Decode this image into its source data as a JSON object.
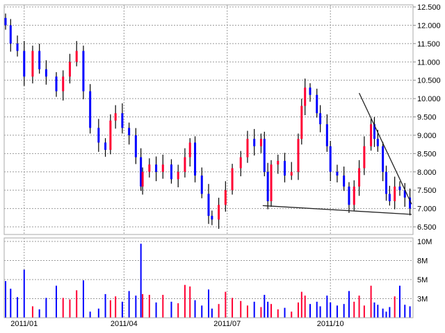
{
  "chart_data": {
    "type": "candlestick",
    "title": "",
    "price_axis": {
      "ticks": [
        "12.500",
        "12.000",
        "11.500",
        "11.000",
        "10.500",
        "10.000",
        "9.500",
        "9.000",
        "8.500",
        "8.000",
        "7.500",
        "7.000",
        "6.500"
      ],
      "ylim": [
        6.5,
        12.5
      ]
    },
    "volume_axis": {
      "ticks": [
        "10M",
        "8M",
        "5M",
        "3M"
      ]
    },
    "x_ticks": [
      {
        "label": "2011/01",
        "t": 11
      },
      {
        "label": "2011/04",
        "t": 70
      },
      {
        "label": "2011/07",
        "t": 131
      },
      {
        "label": "2011/10",
        "t": 192
      }
    ],
    "t_range": [
      0,
      240
    ],
    "points": [
      [
        0,
        12.0,
        4.8
      ],
      [
        3,
        11.5,
        3.8
      ],
      [
        7,
        11.3,
        2.7
      ],
      [
        11,
        10.6,
        6.3
      ],
      [
        16,
        11.3,
        1.5
      ],
      [
        20,
        10.8,
        1.1
      ],
      [
        24,
        10.6,
        2.6
      ],
      [
        30,
        10.2,
        4.2
      ],
      [
        34,
        10.6,
        2.6
      ],
      [
        38,
        11.0,
        2.4
      ],
      [
        42,
        11.3,
        3.6
      ],
      [
        46,
        10.2,
        4.9
      ],
      [
        50,
        9.2,
        0.8
      ],
      [
        55,
        8.8,
        1.2
      ],
      [
        59,
        8.6,
        3.1
      ],
      [
        62,
        9.4,
        2.3
      ],
      [
        65,
        9.6,
        2.8
      ],
      [
        69,
        9.2,
        2.1
      ],
      [
        73,
        9.0,
        3.5
      ],
      [
        77,
        8.4,
        2.9
      ],
      [
        80,
        7.6,
        9.7
      ],
      [
        81,
        8.0,
        3.1
      ],
      [
        85,
        8.2,
        3.0
      ],
      [
        89,
        8.0,
        2.0
      ],
      [
        93,
        8.2,
        3.0
      ],
      [
        98,
        7.8,
        2.1
      ],
      [
        102,
        8.0,
        1.9
      ],
      [
        106,
        8.4,
        4.3
      ],
      [
        109,
        8.8,
        4.1
      ],
      [
        112,
        7.9,
        2.3
      ],
      [
        116,
        7.4,
        1.6
      ],
      [
        120,
        6.8,
        3.7
      ],
      [
        122,
        6.7,
        1.2
      ],
      [
        126,
        7.1,
        1.8
      ],
      [
        130,
        7.5,
        3.4
      ],
      [
        134,
        8.1,
        2.6
      ],
      [
        139,
        8.4,
        2.2
      ],
      [
        143,
        8.9,
        1.6
      ],
      [
        147,
        8.7,
        2.1
      ],
      [
        151,
        8.9,
        1.4
      ],
      [
        153,
        8.0,
        3.0
      ],
      [
        155,
        7.2,
        2.1
      ],
      [
        157,
        8.2,
        1.8
      ],
      [
        161,
        8.3,
        1.1
      ],
      [
        165,
        7.9,
        1.3
      ],
      [
        169,
        8.0,
        0.8
      ],
      [
        173,
        8.9,
        2.0
      ],
      [
        175,
        9.8,
        3.4
      ],
      [
        177,
        10.3,
        2.9
      ],
      [
        180,
        10.1,
        1.8
      ],
      [
        184,
        9.6,
        2.1
      ],
      [
        186,
        9.3,
        1.5
      ],
      [
        190,
        8.7,
        2.9
      ],
      [
        192,
        8.0,
        2.0
      ],
      [
        196,
        7.9,
        1.6
      ],
      [
        200,
        7.6,
        1.8
      ],
      [
        203,
        7.1,
        3.5
      ],
      [
        206,
        7.6,
        2.1
      ],
      [
        209,
        8.1,
        2.9
      ],
      [
        212,
        8.7,
        1.6
      ],
      [
        216,
        9.3,
        4.2
      ],
      [
        218,
        8.9,
        2.0
      ],
      [
        220,
        8.7,
        1.7
      ],
      [
        223,
        8.0,
        1.2
      ],
      [
        225,
        7.4,
        0.8
      ],
      [
        227,
        7.2,
        1.4
      ],
      [
        230,
        7.6,
        2.8
      ],
      [
        233,
        7.5,
        4.2
      ],
      [
        236,
        7.3,
        1.7
      ],
      [
        239,
        7.0,
        1.5
      ]
    ],
    "points_format": [
      "t",
      "close",
      "volume_M"
    ],
    "trendlines": [
      {
        "from": [
          152,
          7.08
        ],
        "to": [
          240,
          6.84
        ]
      },
      {
        "from": [
          209,
          10.15
        ],
        "to": [
          240,
          7.12
        ]
      }
    ],
    "colors": {
      "up": "#ff0033",
      "down": "#0000ff",
      "wick": "#000000",
      "grid": "#999999",
      "trend": "#222222"
    }
  }
}
